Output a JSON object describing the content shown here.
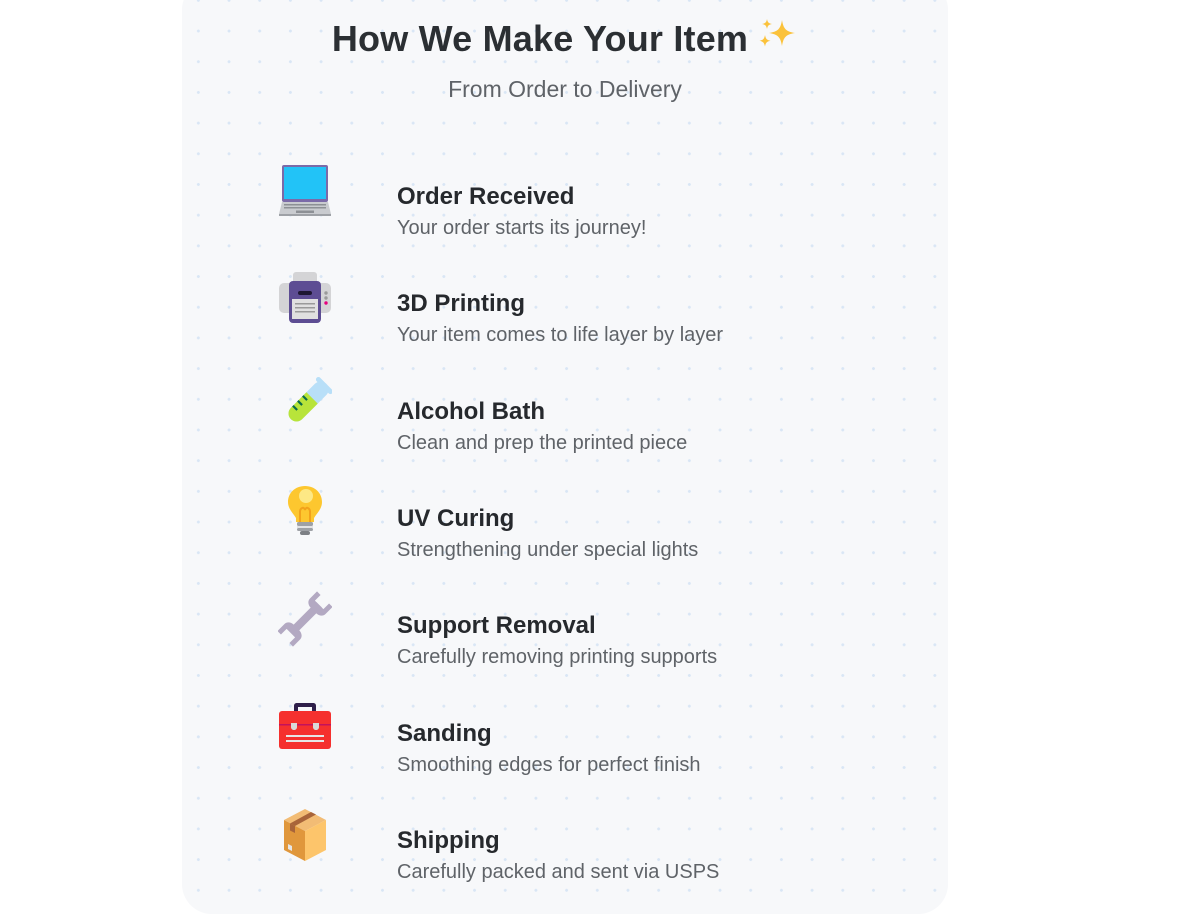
{
  "header": {
    "title": "How We Make Your Item",
    "title_icon": "sparkles-icon",
    "subtitle": "From Order to Delivery"
  },
  "steps": [
    {
      "icon": "laptop-icon",
      "title": "Order Received",
      "description": "Your order starts its journey!"
    },
    {
      "icon": "printer-icon",
      "title": "3D Printing",
      "description": "Your item comes to life layer by layer"
    },
    {
      "icon": "test-tube-icon",
      "title": "Alcohol Bath",
      "description": "Clean and prep the printed piece"
    },
    {
      "icon": "light-bulb-icon",
      "title": "UV Curing",
      "description": "Strengthening under special lights"
    },
    {
      "icon": "wrench-icon",
      "title": "Support Removal",
      "description": "Carefully removing printing supports"
    },
    {
      "icon": "toolbox-icon",
      "title": "Sanding",
      "description": "Smoothing edges for perfect finish"
    },
    {
      "icon": "package-icon",
      "title": "Shipping",
      "description": "Carefully packed and sent via USPS"
    }
  ],
  "colors": {
    "card_background": "#f7f8fa",
    "heading_text": "#2b2f33",
    "body_text": "#5f6368",
    "grid_dot": "#d9e6f5",
    "sparkle": "#fbc23b"
  }
}
